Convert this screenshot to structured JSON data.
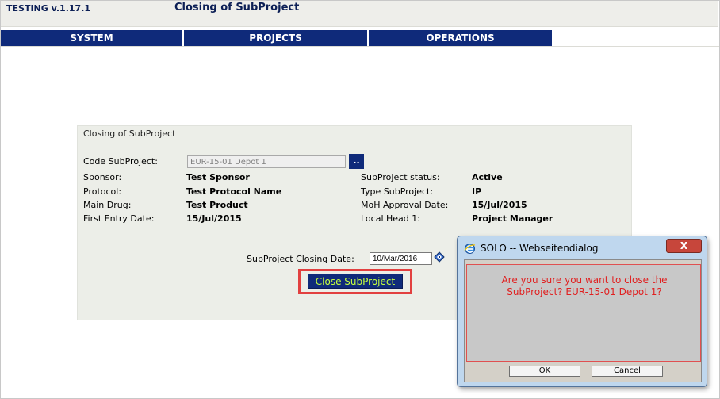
{
  "header": {
    "app_version": "TESTING v.1.17.1",
    "page_title": "Closing of SubProject"
  },
  "nav": {
    "items": [
      "SYSTEM",
      "PROJECTS",
      "OPERATIONS"
    ]
  },
  "form": {
    "title": "Closing of SubProject",
    "code_label": "Code SubProject:",
    "code_value": "EUR-15-01 Depot 1",
    "lookup_button": "..",
    "left_fields": [
      {
        "label": "Sponsor:",
        "value": "Test Sponsor"
      },
      {
        "label": "Protocol:",
        "value": "Test Protocol Name"
      },
      {
        "label": "Main Drug:",
        "value": "Test Product"
      },
      {
        "label": "First Entry Date:",
        "value": "15/Jul/2015"
      }
    ],
    "right_fields": [
      {
        "label": "SubProject status:",
        "value": "Active"
      },
      {
        "label": "Type SubProject:",
        "value": "IP"
      },
      {
        "label": "MoH Approval Date:",
        "value": "15/Jul/2015"
      },
      {
        "label": "Local Head 1:",
        "value": "Project Manager"
      }
    ],
    "closing_date_label": "SubProject Closing Date:",
    "closing_date_value": "10/Mar/2016",
    "close_button": "Close SubProject"
  },
  "dialog": {
    "title": "SOLO -- Webseitendialog",
    "close_glyph": "X",
    "message_line1": "Are you sure you want to close the",
    "message_line2": "SubProject? EUR-15-01 Depot 1?",
    "ok_label": "OK",
    "cancel_label": "Cancel"
  },
  "colors": {
    "nav_bg": "#0f2a7a",
    "button_text": "#c6ff3e",
    "highlight": "#e24040",
    "dialog_message": "#e02020"
  }
}
